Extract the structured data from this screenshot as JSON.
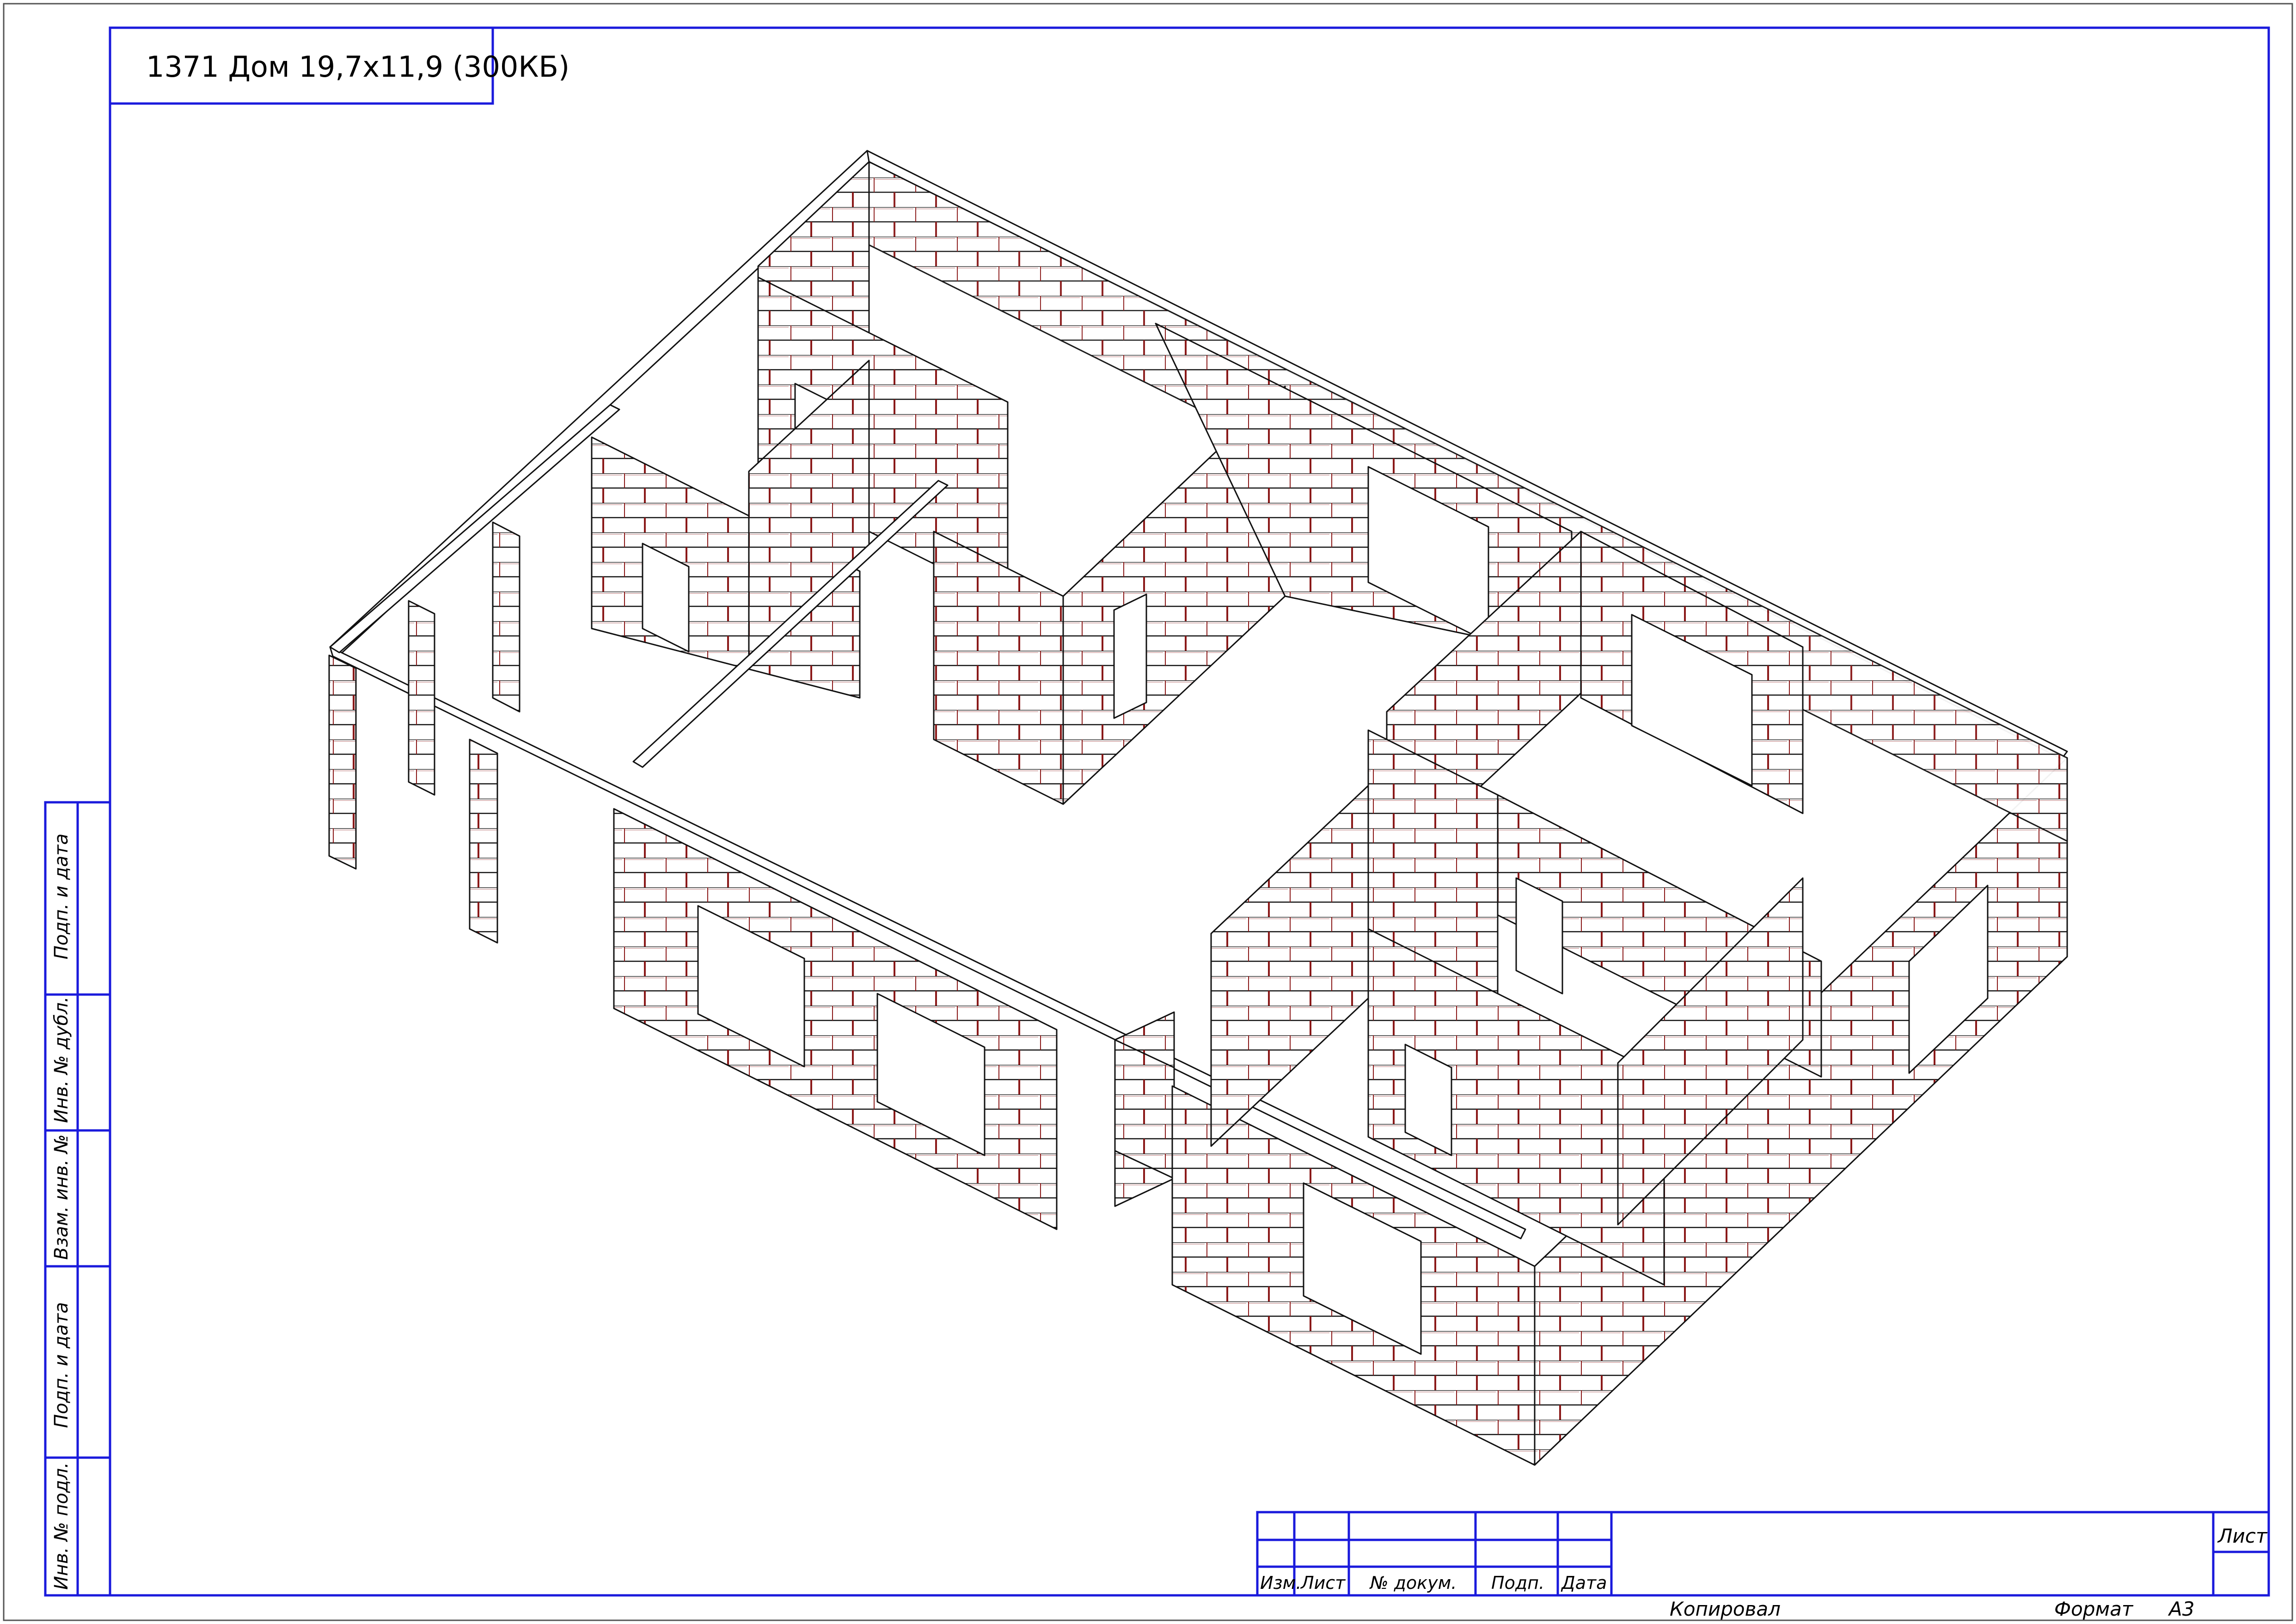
{
  "drawing": {
    "title": "1371 Дом 19,7x11,9 (300КБ)"
  },
  "side_stamp": {
    "fields": [
      "Подп. и дата",
      "Инв. № дубл.",
      "Взам. инв. №",
      "Подп. и дата",
      "Инв. № подл."
    ]
  },
  "title_block": {
    "columns": [
      "Изм.",
      "Лист",
      "№ докум.",
      "Подп.",
      "Дата"
    ],
    "sheet_label": "Лист"
  },
  "footer": {
    "copied_label": "Копировал",
    "format_label": "Формат",
    "format_value": "А3"
  },
  "colors": {
    "frame": "#1a1adc",
    "line": "#000000",
    "brick_mortar": "#8b1a1a",
    "wall_fill": "#ffffff"
  }
}
